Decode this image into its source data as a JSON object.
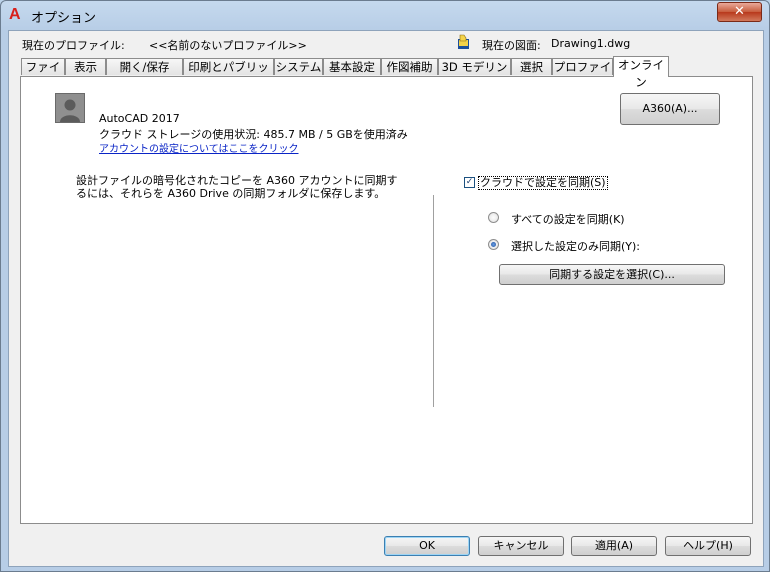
{
  "window": {
    "title": "オプション",
    "close_symbol": "✕"
  },
  "profile": {
    "current_profile_label": "現在のプロファイル:",
    "current_profile_value": "<<名前のないプロファイル>>",
    "current_drawing_label": "現在の図面:",
    "current_drawing_value": "Drawing1.dwg"
  },
  "tabs": [
    {
      "label": "ファイル"
    },
    {
      "label": "表示"
    },
    {
      "label": "開く/保存"
    },
    {
      "label": "印刷とパブリッシュ"
    },
    {
      "label": "システム"
    },
    {
      "label": "基本設定"
    },
    {
      "label": "作図補助"
    },
    {
      "label": "3D モデリング"
    },
    {
      "label": "選択"
    },
    {
      "label": "プロファイル"
    },
    {
      "label": "オンライン"
    }
  ],
  "active_tab": "オンライン",
  "account": {
    "product": "AutoCAD 2017",
    "storage_usage": "クラウド ストレージの使用状況: 485.7 MB / 5 GBを使用済み",
    "settings_link": "アカウントの設定についてはここをクリック",
    "a360_button": "A360(A)..."
  },
  "description": "設計ファイルの暗号化されたコピーを A360 アカウントに同期するには、それらを A360 Drive の同期フォルダに保存します。",
  "sync": {
    "checkbox_label": "クラウドで設定を同期(S)",
    "checkbox_checked": true,
    "option_all": "すべての設定を同期(K)",
    "option_selected": "選択した設定のみ同期(Y):",
    "selected_option": "選択した設定のみ同期(Y):",
    "choose_button": "同期する設定を選択(C)..."
  },
  "buttons": {
    "ok": "OK",
    "cancel": "キャンセル",
    "apply": "適用(A)",
    "help": "ヘルプ(H)"
  },
  "colors": {
    "link": "#0a24c6",
    "logo": "#d8201c"
  }
}
